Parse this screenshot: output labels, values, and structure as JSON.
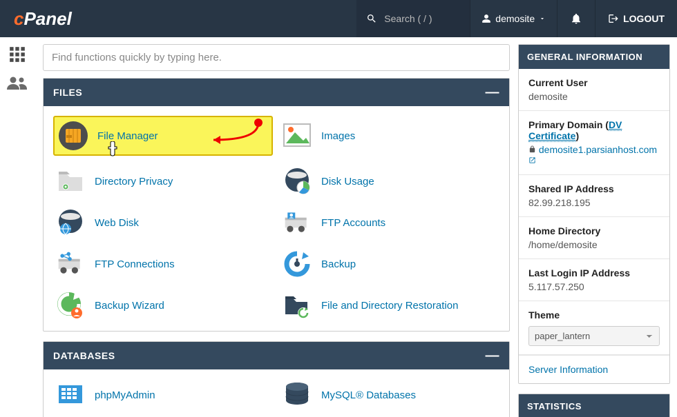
{
  "header": {
    "logo_prefix": "c",
    "logo_rest": "Panel",
    "search_placeholder": "Search ( / )",
    "user_label": "demosite",
    "logout_label": "LOGOUT"
  },
  "find_placeholder": "Find functions quickly by typing here.",
  "panels": {
    "files": {
      "title": "FILES",
      "items": [
        {
          "label": "File Manager",
          "highlight": true
        },
        {
          "label": "Images"
        },
        {
          "label": "Directory Privacy"
        },
        {
          "label": "Disk Usage"
        },
        {
          "label": "Web Disk"
        },
        {
          "label": "FTP Accounts"
        },
        {
          "label": "FTP Connections"
        },
        {
          "label": "Backup"
        },
        {
          "label": "Backup Wizard"
        },
        {
          "label": "File and Directory Restoration"
        }
      ]
    },
    "databases": {
      "title": "DATABASES",
      "items": [
        {
          "label": "phpMyAdmin"
        },
        {
          "label": "MySQL® Databases"
        }
      ]
    }
  },
  "general_info": {
    "title": "GENERAL INFORMATION",
    "current_user_label": "Current User",
    "current_user": "demosite",
    "primary_domain_label": "Primary Domain",
    "dv_cert": "DV Certificate",
    "primary_domain": "demosite1.parsianhost.com",
    "shared_ip_label": "Shared IP Address",
    "shared_ip": "82.99.218.195",
    "home_dir_label": "Home Directory",
    "home_dir": "/home/demosite",
    "last_login_label": "Last Login IP Address",
    "last_login": "5.117.57.250",
    "theme_label": "Theme",
    "theme_value": "paper_lantern",
    "server_info_label": "Server Information"
  },
  "statistics": {
    "title": "STATISTICS"
  }
}
